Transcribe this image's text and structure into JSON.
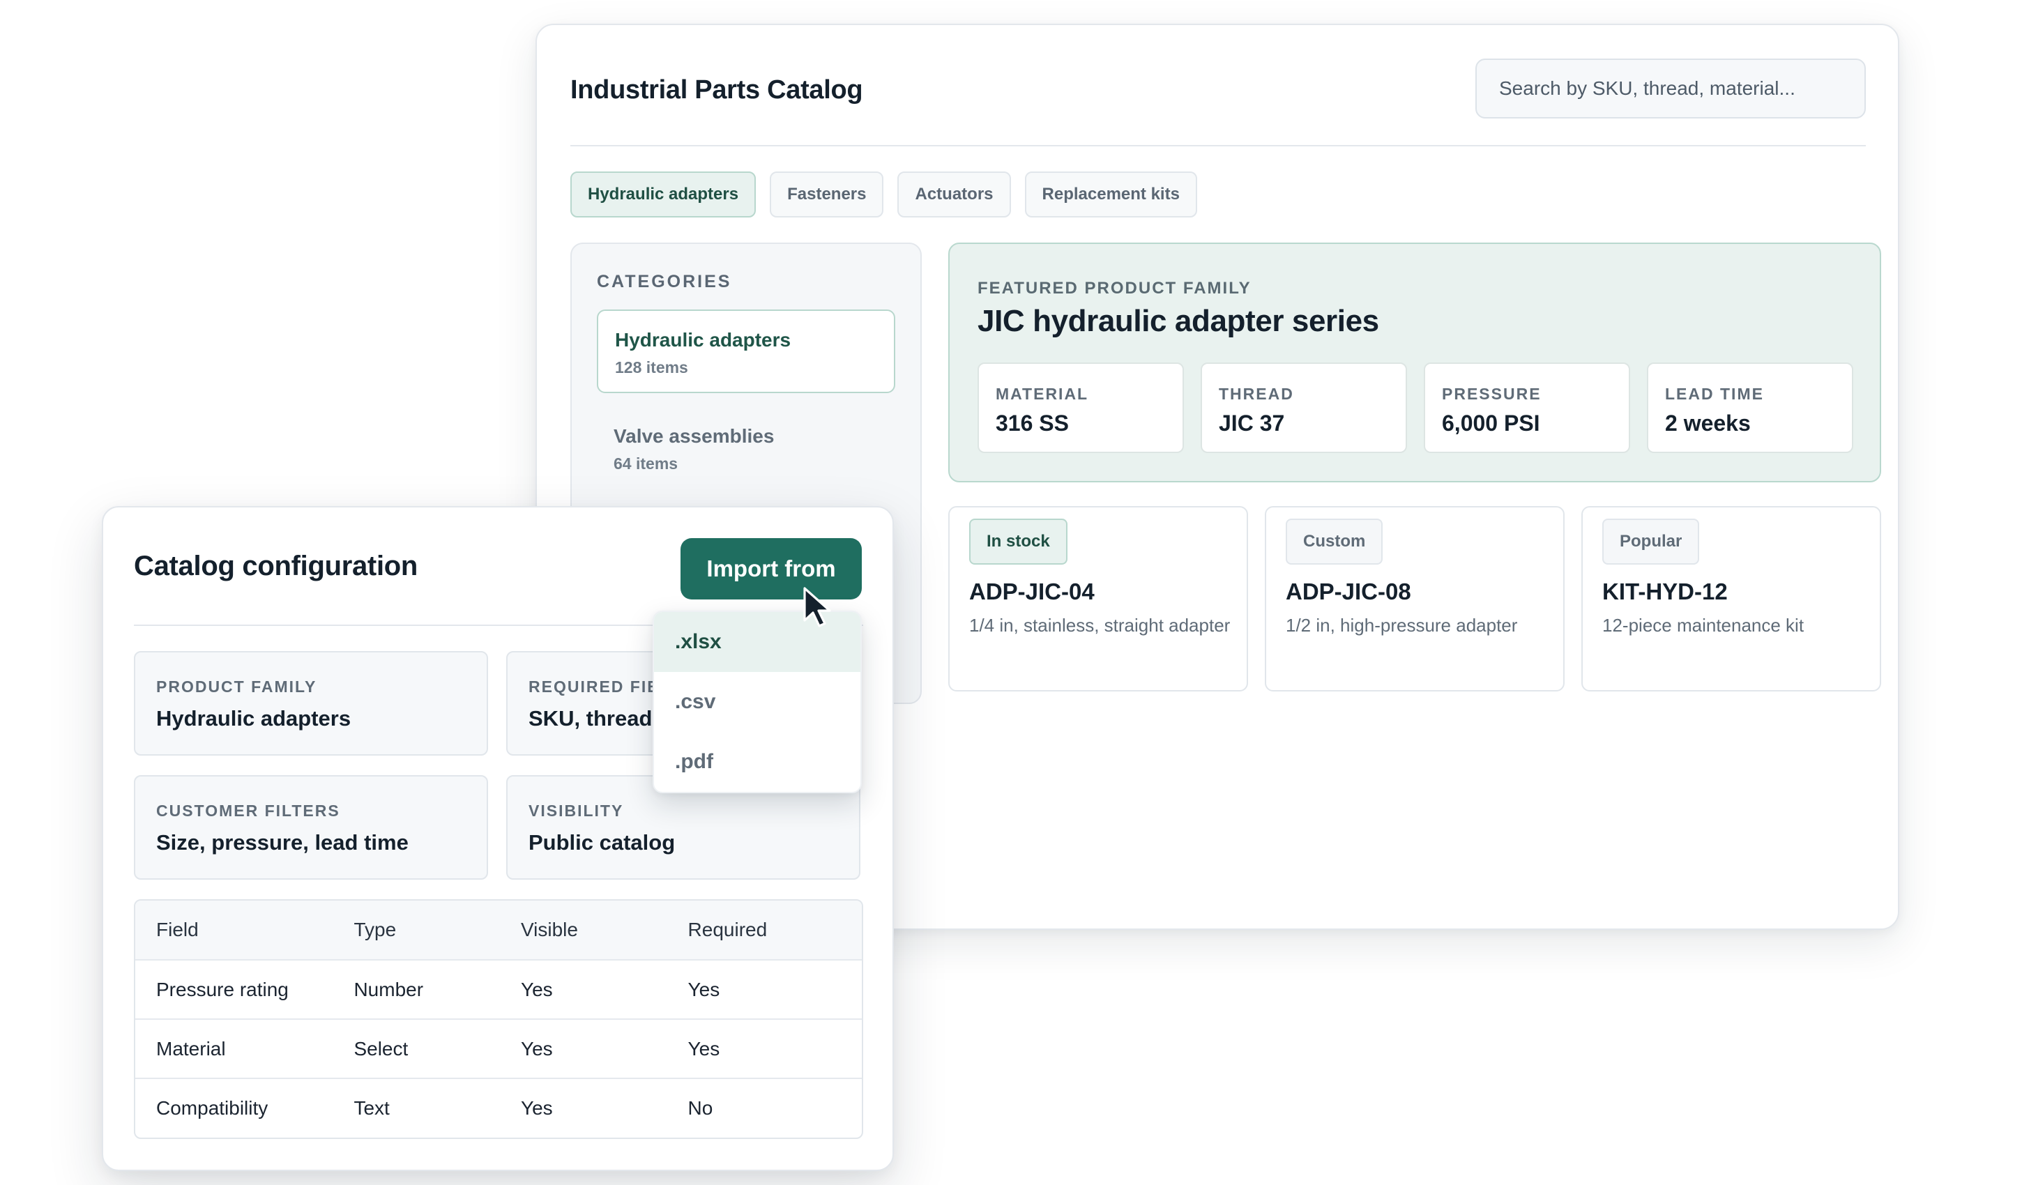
{
  "catalog": {
    "title": "Industrial Parts Catalog",
    "search_placeholder": "Search by SKU, thread, material...",
    "tabs": [
      {
        "label": "Hydraulic adapters",
        "active": true
      },
      {
        "label": "Fasteners"
      },
      {
        "label": "Actuators"
      },
      {
        "label": "Replacement kits"
      }
    ],
    "sidebar": {
      "heading": "CATEGORIES",
      "items": [
        {
          "name": "Hydraulic adapters",
          "count": "128 items",
          "active": true
        },
        {
          "name": "Valve assemblies",
          "count": "64 items"
        }
      ]
    },
    "featured": {
      "eyebrow": "FEATURED PRODUCT FAMILY",
      "title": "JIC hydraulic adapter series",
      "specs": [
        {
          "key": "MATERIAL",
          "value": "316 SS"
        },
        {
          "key": "THREAD",
          "value": "JIC 37"
        },
        {
          "key": "PRESSURE",
          "value": "6,000 PSI"
        },
        {
          "key": "LEAD TIME",
          "value": "2 weeks"
        }
      ]
    },
    "products": [
      {
        "badge": "In stock",
        "sku": "ADP-JIC-04",
        "desc": "1/4 in, stainless, straight adapter"
      },
      {
        "badge": "Custom",
        "sku": "ADP-JIC-08",
        "desc": "1/2 in, high-pressure adapter"
      },
      {
        "badge": "Popular",
        "sku": "KIT-HYD-12",
        "desc": "12-piece maintenance kit"
      }
    ]
  },
  "config": {
    "title": "Catalog configuration",
    "import_label": "Import from",
    "cards": [
      {
        "key": "PRODUCT FAMILY",
        "value": "Hydraulic adapters"
      },
      {
        "key": "REQUIRED FIE",
        "value": "SKU, thread"
      },
      {
        "key": "CUSTOMER FILTERS",
        "value": "Size, pressure, lead time"
      },
      {
        "key": "VISIBILITY",
        "value": "Public catalog"
      }
    ],
    "table": {
      "headers": [
        "Field",
        "Type",
        "Visible",
        "Required"
      ],
      "rows": [
        [
          "Pressure rating",
          "Number",
          "Yes",
          "Yes"
        ],
        [
          "Material",
          "Select",
          "Yes",
          "Yes"
        ],
        [
          "Compatibility",
          "Text",
          "Yes",
          "No"
        ]
      ]
    },
    "dropdown": {
      "options": [
        ".xlsx",
        ".csv",
        ".pdf"
      ],
      "selected": ".xlsx"
    }
  },
  "colors": {
    "accent": "#1f6e60",
    "accent_soft": "#e8f2ef",
    "accent_border": "#b8d7cd"
  }
}
